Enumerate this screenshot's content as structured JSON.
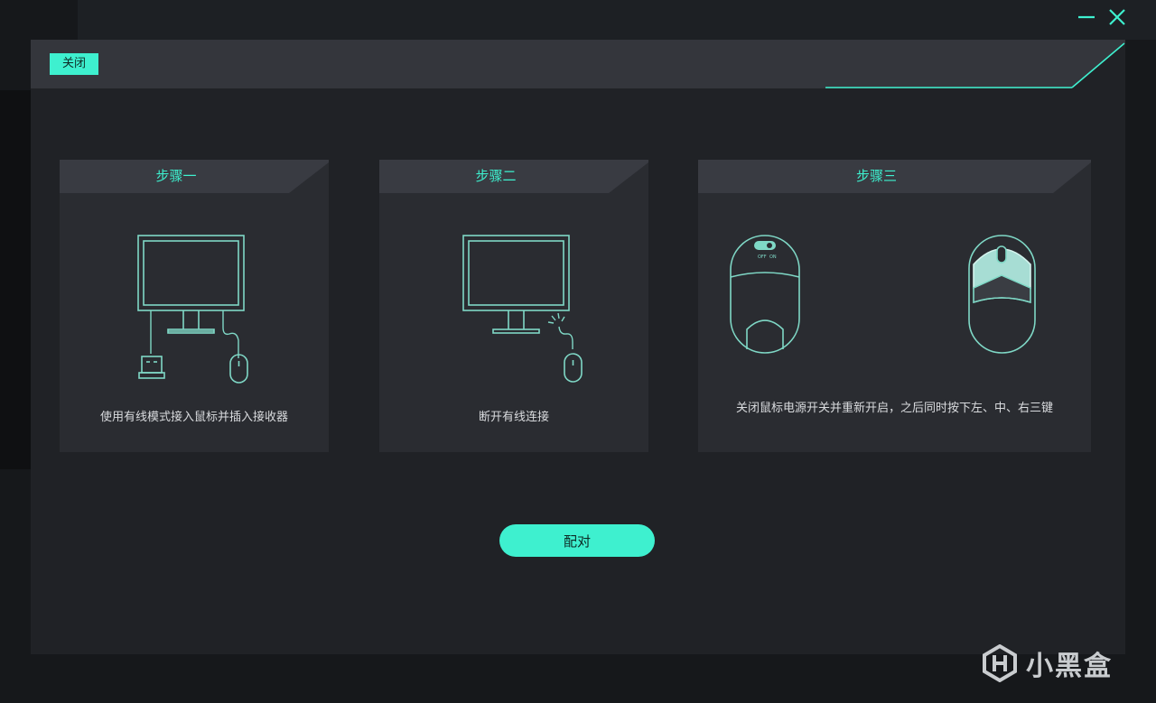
{
  "dialog": {
    "close_label": "关闭",
    "pair_label": "配对"
  },
  "steps": [
    {
      "title": "步骤一",
      "description": "使用有线模式接入鼠标并插入接收器"
    },
    {
      "title": "步骤二",
      "description": "断开有线连接"
    },
    {
      "title": "步骤三",
      "description": "关闭鼠标电源开关并重新开启，之后同时按下左、中、右三键"
    }
  ],
  "illustration": {
    "switch_off": "OFF",
    "switch_on": "ON"
  },
  "watermark": {
    "text": "小黑盒"
  },
  "icons": [
    "minimize-icon",
    "close-icon",
    "monitor-icon",
    "usb-receiver-icon",
    "mouse-icon",
    "disconnect-icon",
    "mouse-bottom-icon",
    "mouse-top-icon",
    "xiaoheihe-logo-icon"
  ],
  "colors": {
    "accent": "#3ef0cf",
    "panel": "#202226",
    "card": "#2a2c31",
    "line": "#7fd8c6"
  }
}
